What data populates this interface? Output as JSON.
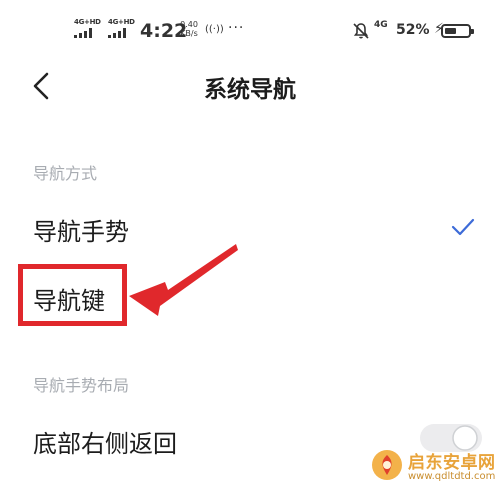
{
  "status_bar": {
    "sim1_tag": "4G+HD",
    "sim2_tag": "4G+HD",
    "time": "4:22",
    "net_speed_value": "0.40",
    "net_speed_unit": "KB/s",
    "hotspot": "((·))",
    "more": "···",
    "network_type": "4G",
    "battery_percent": "52%",
    "battery_level": 0.52
  },
  "header": {
    "title": "系统导航"
  },
  "navigation_mode": {
    "section_title": "导航方式",
    "options": [
      {
        "label": "导航手势",
        "selected": true
      },
      {
        "label": "导航键",
        "selected": false
      }
    ]
  },
  "gesture_layout": {
    "section_title": "导航手势布局",
    "options": [
      {
        "label": "底部右侧返回",
        "toggle_on": false
      }
    ]
  },
  "colors": {
    "accent": "#3d6bd8",
    "annotation_red": "#e0282c",
    "section_gray": "#a8acb2"
  },
  "watermark": {
    "name": "启东安卓网",
    "url": "www.qdltdtd.com"
  }
}
